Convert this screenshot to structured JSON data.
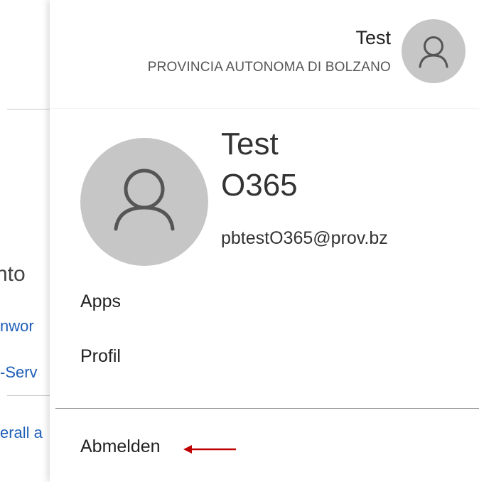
{
  "background": {
    "heading": "nto",
    "link_1": "nwor",
    "link_2": "-Serv",
    "link_3": "erall a"
  },
  "header": {
    "name": "Test",
    "organization": "PROVINCIA AUTONOMA DI BOLZANO",
    "avatar_icon": "person-icon"
  },
  "profile": {
    "first_name": "Test",
    "last_name": "O365",
    "email": "pbtestO365@prov.bz",
    "avatar_icon": "person-icon"
  },
  "menu": {
    "apps": "Apps",
    "profil": "Profil",
    "abmelden": "Abmelden"
  },
  "annotation": {
    "arrow_color": "#c00000",
    "icon": "left-arrow-icon"
  },
  "colors": {
    "avatar_bg": "#c6c6c6",
    "link": "#1f5fb8"
  }
}
